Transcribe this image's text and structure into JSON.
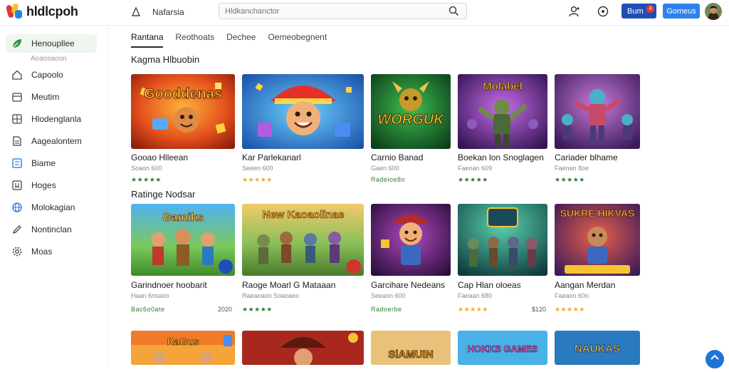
{
  "app": {
    "name": "hldlcpoh"
  },
  "topbar": {
    "nav_label": "Nafarsia",
    "search_placeholder": "Hldkanchanctor",
    "btn_primary": "Bum",
    "notif_count": "4",
    "btn_secondary": "Gomeus"
  },
  "sidebar": {
    "items": [
      {
        "label": "Henoupllee",
        "icon": "leaf-icon"
      },
      {
        "label": "Capoolo",
        "icon": "home-icon"
      },
      {
        "label": "Meutim",
        "icon": "calendar-icon"
      },
      {
        "label": "Hlodenglanla",
        "icon": "grid-icon"
      },
      {
        "label": "Aagealontem",
        "icon": "document-icon"
      },
      {
        "label": "Biame",
        "icon": "note-icon"
      },
      {
        "label": "Hoges",
        "icon": "bookmark-icon"
      },
      {
        "label": "Molokagian",
        "icon": "globe-icon"
      },
      {
        "label": "Nontinclan",
        "icon": "pen-icon"
      },
      {
        "label": "Moas",
        "icon": "gear-icon"
      }
    ],
    "sub_label": "Aoaosaoon"
  },
  "tabs": [
    {
      "label": "Rantana",
      "active": true
    },
    {
      "label": "Reothoats"
    },
    {
      "label": "Dechee"
    },
    {
      "label": "Oemeobegnent"
    }
  ],
  "sections": [
    {
      "title": "Kagma Hlbuobin",
      "cards": [
        {
          "title": "Gooao Hlleean",
          "sub": "Soaon 600",
          "rating": "★★★★★",
          "rating_color": "#2e7d32",
          "price": ""
        },
        {
          "title": "Kar Parlekanarl",
          "sub": "Seeen 600",
          "rating": "★★★★★",
          "rating_color": "#f9a825",
          "price": ""
        },
        {
          "title": "Carnio Banad",
          "sub": "Gaen 600",
          "rating": "Radeioe8o",
          "rating_color": "#2e7d32",
          "price": ""
        },
        {
          "title": "Boekan lon Snoglagen",
          "sub": "Faenan 609",
          "rating": "★★★★★",
          "rating_color": "#2e7d32",
          "price": ""
        },
        {
          "title": "Cariader blhame",
          "sub": "Faenan 8oe",
          "rating": "★★★★★",
          "rating_color": "#2e7d32",
          "price": ""
        }
      ]
    },
    {
      "title": "Ratinge Nodsar",
      "cards": [
        {
          "title": "Garindnoer hoobarit",
          "sub": "Haan 6nsaoo",
          "rating": "Bac6o0ate",
          "rating_color": "#2e7d32",
          "price": "2020"
        },
        {
          "title": "Raoge Moarl G Mataaan",
          "sub": "Raeaoaoo   Soaoaoo",
          "rating": "★★★★★",
          "rating_color": "#2e7d32",
          "price": ""
        },
        {
          "title": "Garcihare Nedeans",
          "sub": "Seeaon 600",
          "rating": "Radoerbe",
          "rating_color": "#2e7d32",
          "price": ""
        },
        {
          "title": "Cap Hlan oloeas",
          "sub": "Faeaan 680",
          "rating": "★★★★★",
          "rating_color": "#f9a825",
          "price": "$120"
        },
        {
          "title": "Aangan Merdan",
          "sub": "Faeaon 60o",
          "rating": "★★★★★",
          "rating_color": "#f9a825",
          "price": ""
        }
      ]
    },
    {
      "title": "",
      "cards": [
        {
          "title": "",
          "sub": "",
          "rating": "",
          "price": "",
          "art_text": "RaGus"
        },
        {
          "title": "",
          "sub": "",
          "rating": "",
          "price": "",
          "art_text": ""
        },
        {
          "title": "",
          "sub": "",
          "rating": "",
          "price": "",
          "art_text": "SlAMUIN"
        },
        {
          "title": "",
          "sub": "",
          "rating": "",
          "price": "",
          "art_text": "HOKKS GAMES"
        },
        {
          "title": "",
          "sub": "",
          "rating": "",
          "price": "",
          "art_text": "NAUKAS"
        }
      ]
    }
  ],
  "art": {
    "row1": [
      "Gooddenas",
      "",
      "WORGUK",
      "Molabel",
      ""
    ],
    "row2": [
      "Gamiks",
      "New Kaoaolinae",
      "",
      "",
      "SUKRE HIKVAS"
    ]
  },
  "colors": {
    "accent": "#1f4fb4",
    "secondary": "#2f80ed",
    "active_bg": "#eef6ee"
  }
}
